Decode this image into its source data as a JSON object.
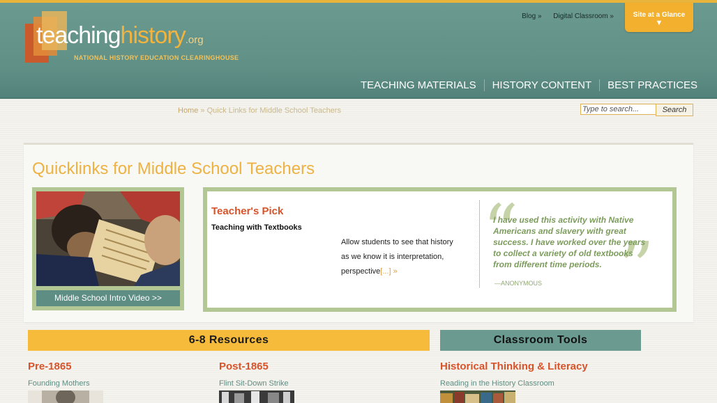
{
  "header": {
    "logo": {
      "word1": "teaching",
      "word2": "history",
      "suffix": ".org",
      "tagline": "NATIONAL HISTORY EDUCATION CLEARINGHOUSE"
    },
    "utility_links": [
      "Blog »",
      "Digital Classroom »"
    ],
    "site_at_glance": {
      "label": "Site at a Glance",
      "arrow": "▼"
    },
    "nav": [
      "TEACHING MATERIALS",
      "HISTORY CONTENT",
      "BEST PRACTICES"
    ]
  },
  "breadcrumb": {
    "home": "Home",
    "sep": " » ",
    "current": "Quick Links for Middle School Teachers"
  },
  "search": {
    "placeholder": "Type to search...",
    "button": "Search"
  },
  "page": {
    "title": "Quicklinks for Middle School Teachers"
  },
  "video": {
    "button": "Middle School Intro Video >>"
  },
  "teachers_pick": {
    "heading": "Teacher's Pick",
    "subtitle": "Teaching with Textbooks",
    "description": "Allow students to see that history as we know it is interpretation, perspective",
    "more": "[...] »",
    "quote": "I have used this activity with Native Americans and slavery with great success. I have worked over the years to collect a variety of old textbooks from different time periods.",
    "attribution": "—ANONYMOUS"
  },
  "sections": {
    "resources": {
      "title": "6-8 Resources",
      "columns": [
        {
          "heading": "Pre-1865",
          "first_link": "Founding Mothers"
        },
        {
          "heading": "Post-1865",
          "first_link": "Flint Sit-Down Strike"
        }
      ]
    },
    "tools": {
      "title": "Classroom Tools",
      "heading": "Historical Thinking & Literacy",
      "first_link": "Reading in the History Classroom"
    }
  },
  "colors": {
    "accent_orange": "#f6bb3a",
    "teal": "#6a9a90",
    "title_gold": "#eeb243",
    "heading_red": "#d8532a"
  }
}
